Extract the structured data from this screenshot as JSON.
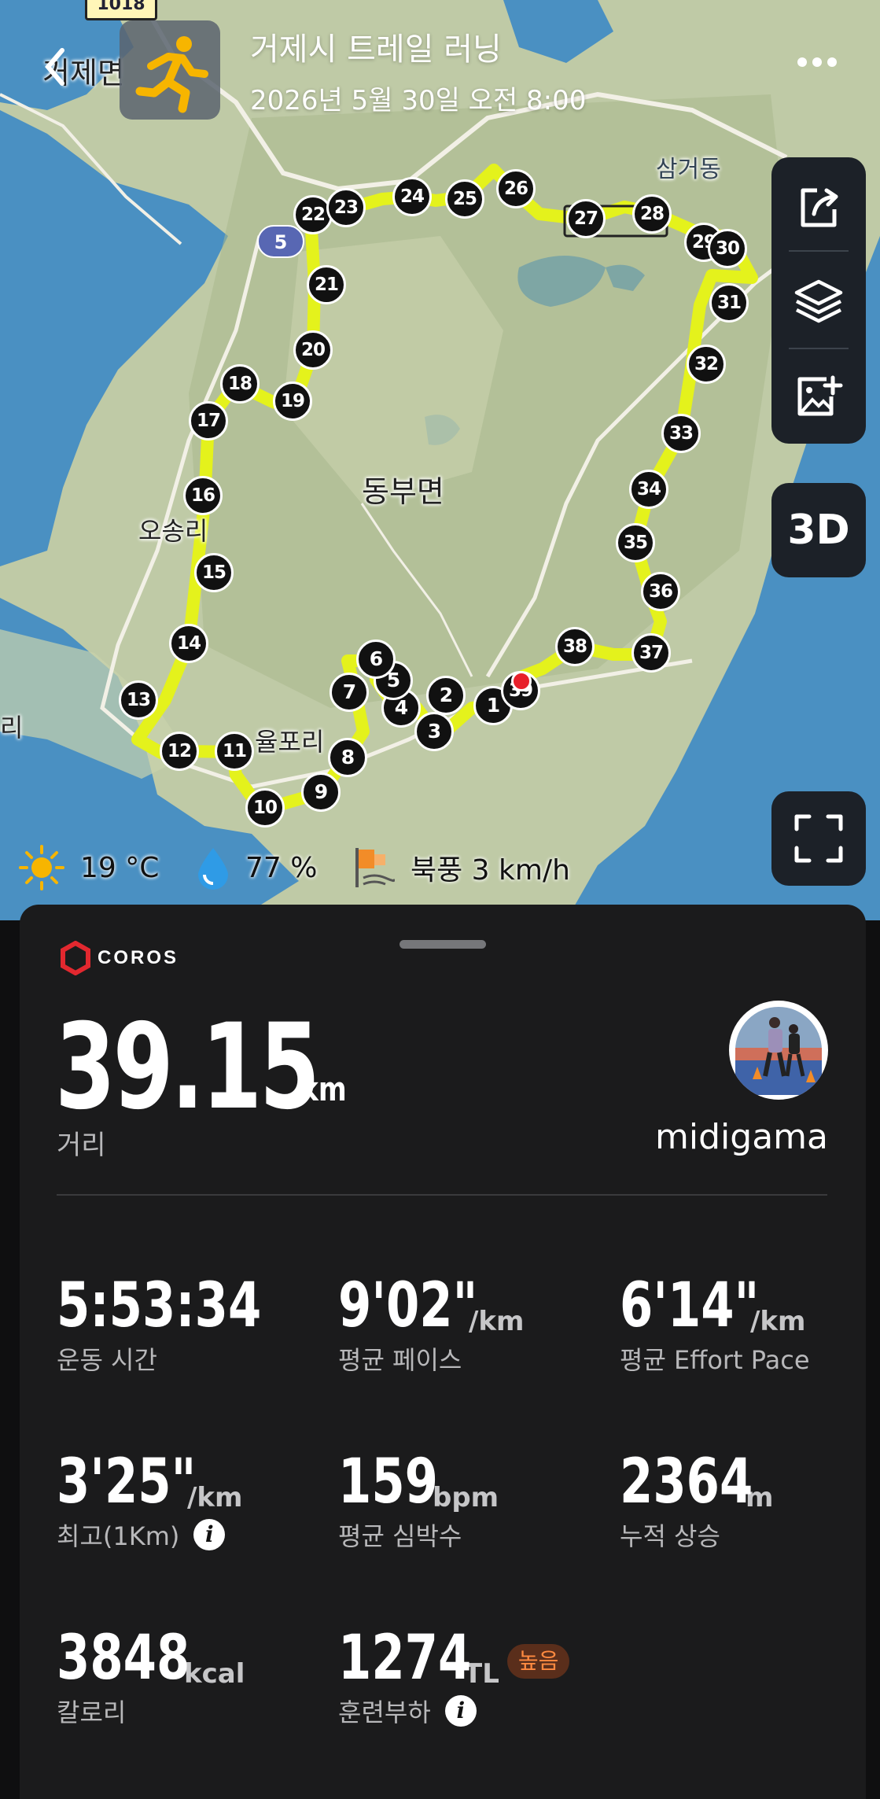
{
  "header": {
    "title": "거제시 트레일 러닝",
    "datetime": "2026년 5월 30일 오전 8:00",
    "sport_icon": "running-person-icon",
    "back_icon": "chevron-left-icon",
    "more_icon": "more-dots-icon"
  },
  "map": {
    "labels": {
      "geoje_myeon": "거제면",
      "samgeo_dong": "삼거동",
      "dongbu_myeon": "동부면",
      "osong_ri": "오송리",
      "yulpo_ri": "율포리",
      "edge_ri": "리"
    },
    "road_sign": "1018",
    "route_sign": "5",
    "route_color": "#E4F21C",
    "water_color": "#4A90C2",
    "land_color": "#BFCAA6",
    "markers": [
      "1",
      "2",
      "3",
      "4",
      "5",
      "6",
      "7",
      "8",
      "9",
      "10",
      "11",
      "12",
      "13",
      "14",
      "15",
      "16",
      "17",
      "18",
      "19",
      "20",
      "21",
      "22",
      "23",
      "24",
      "25",
      "26",
      "27",
      "28",
      "29",
      "30",
      "31",
      "32",
      "33",
      "34",
      "35",
      "36",
      "37",
      "38",
      "39"
    ],
    "start_marker_color": "#E8202A"
  },
  "map_controls": {
    "share_icon": "share-icon",
    "layers_icon": "layers-icon",
    "add_photo_icon": "add-photo-icon",
    "btn_3d": "3D",
    "fullscreen_icon": "fullscreen-icon"
  },
  "weather": {
    "temperature": "19 °C",
    "humidity": "77 %",
    "wind": "북풍 3 km/h",
    "sun_icon": "sun-icon",
    "humidity_icon": "water-drop-icon",
    "wind_icon": "wind-flag-icon"
  },
  "card": {
    "brand": "COROS",
    "distance": "39.15",
    "distance_unit": "km",
    "distance_label": "거리",
    "username": "midigama",
    "stats": {
      "workout_time": {
        "value": "5:53:34",
        "unit": "",
        "label": "운동 시간"
      },
      "avg_pace": {
        "value": "9'02\"",
        "unit": "/km",
        "label": "평균 페이스"
      },
      "avg_effort_pace": {
        "value": "6'14\"",
        "unit": "/km",
        "label": "평균 Effort Pace"
      },
      "best_1km": {
        "value": "3'25\"",
        "unit": "/km",
        "label": "최고(1Km)"
      },
      "avg_hr": {
        "value": "159",
        "unit": "bpm",
        "label": "평균 심박수"
      },
      "elev_gain": {
        "value": "2364",
        "unit": "m",
        "label": "누적 상승"
      },
      "calories": {
        "value": "3848",
        "unit": "kcal",
        "label": "칼로리"
      },
      "training_load": {
        "value": "1274",
        "unit": "TL",
        "label": "훈련부하",
        "badge": "높음"
      }
    }
  }
}
